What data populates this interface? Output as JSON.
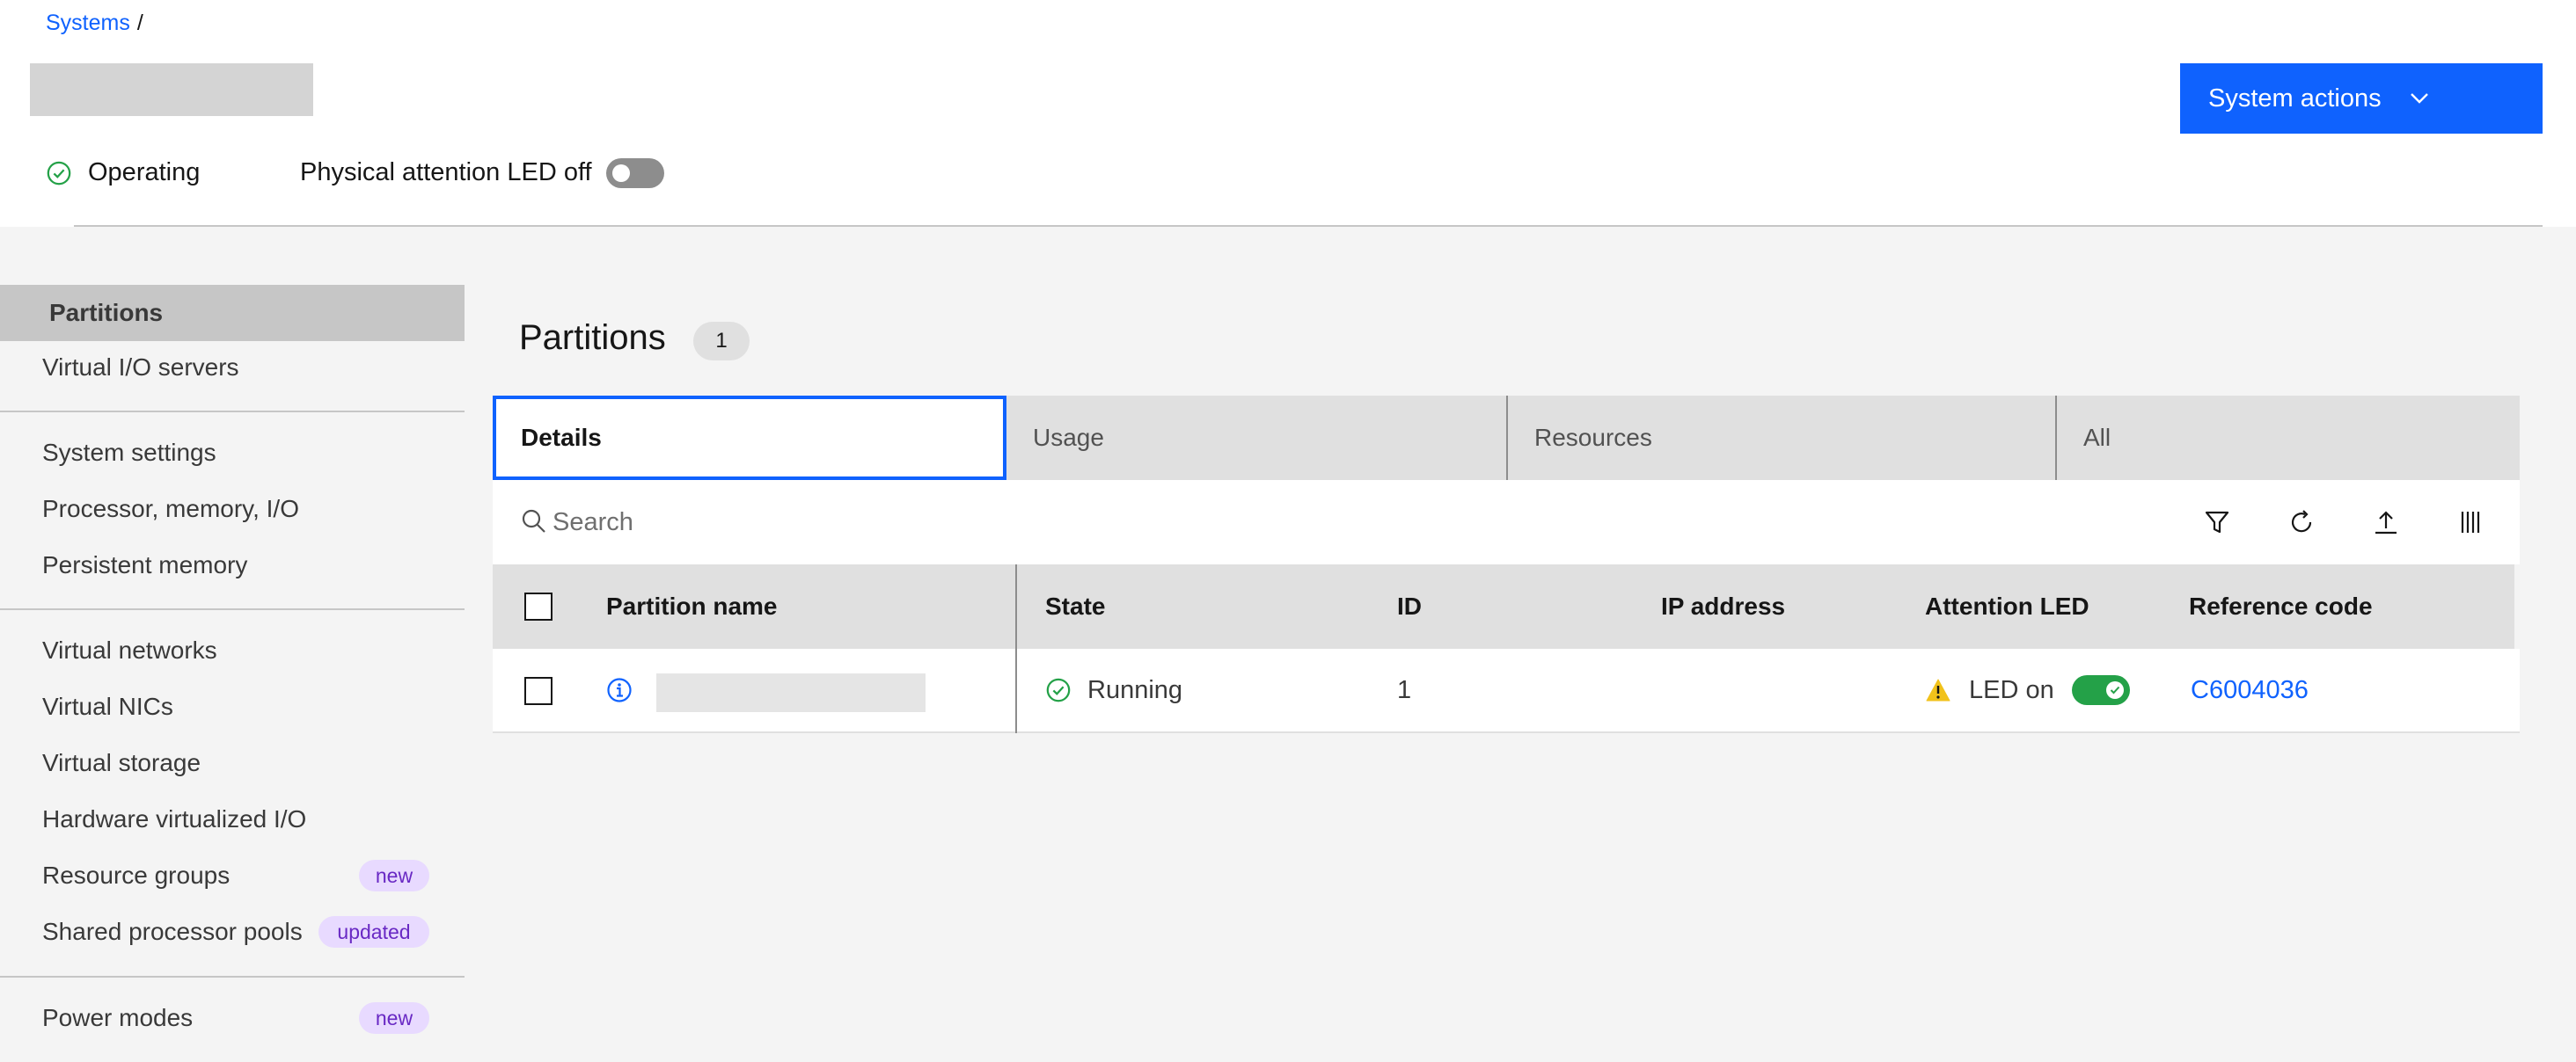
{
  "breadcrumb": {
    "systems": "Systems",
    "separator": "/"
  },
  "header": {
    "status": "Operating",
    "led_label": "Physical attention LED off",
    "actions_button": "System actions"
  },
  "sidebar": {
    "items": [
      {
        "label": "Partitions"
      },
      {
        "label": "Virtual I/O servers"
      },
      {
        "label": "System settings"
      },
      {
        "label": "Processor, memory, I/O"
      },
      {
        "label": "Persistent memory"
      },
      {
        "label": "Virtual networks"
      },
      {
        "label": "Virtual NICs"
      },
      {
        "label": "Virtual storage"
      },
      {
        "label": "Hardware virtualized I/O"
      },
      {
        "label": "Resource groups",
        "tag": "new"
      },
      {
        "label": "Shared processor pools",
        "tag": "updated"
      },
      {
        "label": "Power modes",
        "tag": "new"
      }
    ]
  },
  "main": {
    "title": "Partitions",
    "count": "1",
    "tabs": [
      {
        "label": "Details"
      },
      {
        "label": "Usage"
      },
      {
        "label": "Resources"
      },
      {
        "label": "All"
      }
    ],
    "search": {
      "placeholder": "Search"
    }
  },
  "table": {
    "columns": [
      "Partition name",
      "State",
      "ID",
      "IP address",
      "Attention LED",
      "Reference code"
    ],
    "rows": [
      {
        "state": "Running",
        "id": "1",
        "ip_address": "",
        "attention_led": "LED on",
        "reference_code": "C6004036"
      }
    ]
  },
  "colors": {
    "primary": "#0f62fe",
    "success": "#24a148",
    "warning": "#f1c21b",
    "tag_bg": "#e8daff",
    "tag_text": "#6929c4"
  },
  "icons": [
    "check-circle-icon",
    "chevron-down-icon",
    "search-icon",
    "filter-icon",
    "refresh-icon",
    "export-icon",
    "columns-icon",
    "info-icon",
    "warning-icon",
    "checkmark-icon"
  ]
}
